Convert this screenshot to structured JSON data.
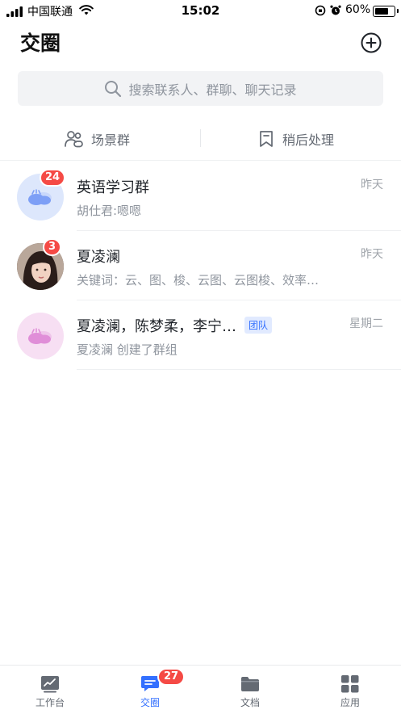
{
  "status_bar": {
    "carrier": "中国联通",
    "time": "15:02",
    "battery": "60%",
    "battery_level": 0.6,
    "icons": [
      "signal-icon",
      "wifi-icon",
      "orientation-lock-icon",
      "alarm-icon",
      "battery-icon"
    ]
  },
  "header": {
    "title": "交圈",
    "add_icon": "plus-circle-icon"
  },
  "search": {
    "placeholder": "搜索联系人、群聊、聊天记录",
    "icon": "search-icon"
  },
  "quick_actions": [
    {
      "label": "场景群",
      "icon": "group-users-icon"
    },
    {
      "label": "稍后处理",
      "icon": "bookmark-icon"
    }
  ],
  "chats": [
    {
      "name": "英语学习群",
      "preview": "胡仕君:嗯嗯",
      "time": "昨天",
      "badge": "24",
      "avatar": "group-avatar-blue"
    },
    {
      "name": "夏凌澜",
      "preview": "关键词：云、图、梭、云图、云图梭、效率…",
      "time": "昨天",
      "badge": "3",
      "avatar": "photo-avatar"
    },
    {
      "name": "夏凌澜，陈梦柔，李宁…",
      "tag": "团队",
      "preview": "夏凌澜 创建了群组",
      "time": "星期二",
      "avatar": "group-avatar-pink"
    }
  ],
  "tabbar": {
    "tabs": [
      {
        "label": "工作台",
        "icon": "workbench-icon",
        "active": false
      },
      {
        "label": "交圈",
        "icon": "chat-icon",
        "active": true,
        "badge": "27"
      },
      {
        "label": "文档",
        "icon": "folder-icon",
        "active": false
      },
      {
        "label": "应用",
        "icon": "apps-grid-icon",
        "active": false
      }
    ]
  },
  "colors": {
    "accent": "#3370ff",
    "badge": "#f54a45",
    "muted_text": "#8f959e",
    "search_bg": "#f2f3f5"
  }
}
